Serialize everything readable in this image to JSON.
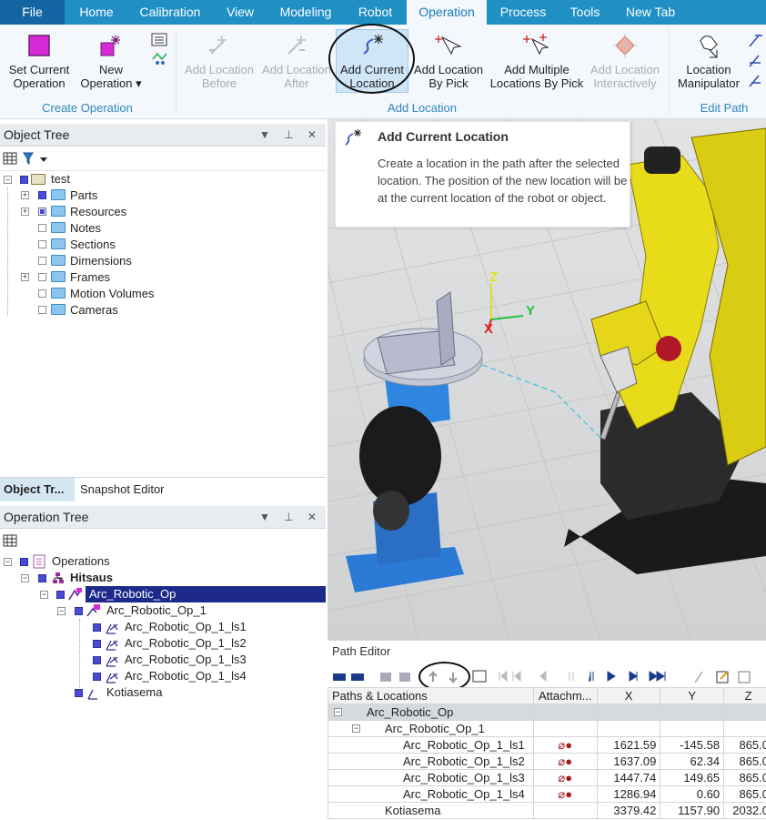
{
  "menu": {
    "tabs": [
      {
        "label": "File"
      },
      {
        "label": "Home"
      },
      {
        "label": "Calibration"
      },
      {
        "label": "View"
      },
      {
        "label": "Modeling"
      },
      {
        "label": "Robot"
      },
      {
        "label": "Operation"
      },
      {
        "label": "Process"
      },
      {
        "label": "Tools"
      },
      {
        "label": "New Tab"
      }
    ],
    "active": "Operation"
  },
  "ribbon": {
    "groups": [
      {
        "label": "Create Operation"
      },
      {
        "label": "Add Location"
      },
      {
        "label": "Edit Path"
      }
    ],
    "buttons": {
      "set_current": {
        "line1": "Set Current",
        "line2": "Operation"
      },
      "new_operation": {
        "line1": "New",
        "line2": "Operation ▾"
      },
      "add_before": {
        "line1": "Add Location",
        "line2": "Before"
      },
      "add_after": {
        "line1": "Add Location",
        "line2": "After"
      },
      "add_current": {
        "line1": "Add Current",
        "line2": "Location"
      },
      "add_by_pick": {
        "line1": "Add Location",
        "line2": "By Pick"
      },
      "add_multiple": {
        "line1": "Add Multiple",
        "line2": "Locations By Pick"
      },
      "add_interactive": {
        "line1": "Add Location",
        "line2": "Interactively"
      },
      "location_manipulator": {
        "line1": "Location",
        "line2": "Manipulator"
      }
    }
  },
  "tooltip": {
    "title": "Add Current Location",
    "body": "Create a location in the path after the selected location. The position of the new location will be at the current location of the robot or object."
  },
  "object_tree": {
    "title": "Object Tree",
    "root": "test",
    "items": [
      {
        "label": "Parts"
      },
      {
        "label": "Resources"
      },
      {
        "label": "Notes"
      },
      {
        "label": "Sections"
      },
      {
        "label": "Dimensions"
      },
      {
        "label": "Frames"
      },
      {
        "label": "Motion Volumes"
      },
      {
        "label": "Cameras"
      }
    ]
  },
  "panel_tabs": {
    "tab1": "Object Tr...",
    "tab2": "Snapshot Editor"
  },
  "operation_tree": {
    "title": "Operation Tree",
    "root": "Operations",
    "hitsaus": "Hitsaus",
    "arc_op": "Arc_Robotic_Op",
    "arc_op1": "Arc_Robotic_Op_1",
    "locations": [
      "Arc_Robotic_Op_1_ls1",
      "Arc_Robotic_Op_1_ls2",
      "Arc_Robotic_Op_1_ls3",
      "Arc_Robotic_Op_1_ls4"
    ],
    "kotiasema": "Kotiasema"
  },
  "viewport": {
    "axis_z": "Z",
    "axis_y": "Y",
    "axis_x": "X"
  },
  "path_editor": {
    "title": "Path Editor",
    "columns": [
      "Paths & Locations",
      "Attachm...",
      "X",
      "Y",
      "Z"
    ],
    "rows": [
      {
        "name": "Arc_Robotic_Op",
        "x": "",
        "y": "",
        "z": ""
      },
      {
        "name": "Arc_Robotic_Op_1",
        "x": "",
        "y": "",
        "z": ""
      },
      {
        "name": "Arc_Robotic_Op_1_ls1",
        "x": "1621.59",
        "y": "-145.58",
        "z": "865.0"
      },
      {
        "name": "Arc_Robotic_Op_1_ls2",
        "x": "1637.09",
        "y": "62.34",
        "z": "865.0"
      },
      {
        "name": "Arc_Robotic_Op_1_ls3",
        "x": "1447.74",
        "y": "149.65",
        "z": "865.0"
      },
      {
        "name": "Arc_Robotic_Op_1_ls4",
        "x": "1286.94",
        "y": "0.60",
        "z": "865.0"
      },
      {
        "name": "Kotiasema",
        "x": "3379.42",
        "y": "1157.90",
        "z": "2032.0"
      }
    ]
  }
}
